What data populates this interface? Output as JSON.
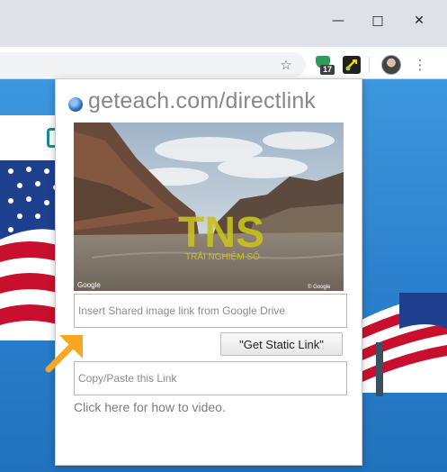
{
  "window": {
    "minimize_icon": "minimize-icon",
    "maximize_icon": "maximize-icon",
    "close_icon": "close-icon"
  },
  "toolbar": {
    "bookmark_icon": "star-icon",
    "extensions": [
      {
        "icon": "shield-extension-icon",
        "badge": "17"
      },
      {
        "icon": "link-extension-icon"
      }
    ],
    "profile_icon": "avatar",
    "menu_icon": "kebab-menu-icon"
  },
  "popup": {
    "title": "geteach.com/directlink",
    "logo_icon": "globe-icon",
    "preview": {
      "watermark_main": "TNS",
      "watermark_sub": "TRẢI NGHIỆM SỐ",
      "corner_left": "Google",
      "corner_right": "© Google"
    },
    "shared_link_placeholder": "Insert Shared image link from Google Drive",
    "get_static_button": "\"Get Static Link\"",
    "copy_placeholder": "Copy/Paste this Link",
    "howto_link": "Click here for how to video."
  },
  "colors": {
    "accent_arrow": "#f5a623",
    "watermark": "#c9c21a",
    "desktop": "#2b86d3"
  }
}
